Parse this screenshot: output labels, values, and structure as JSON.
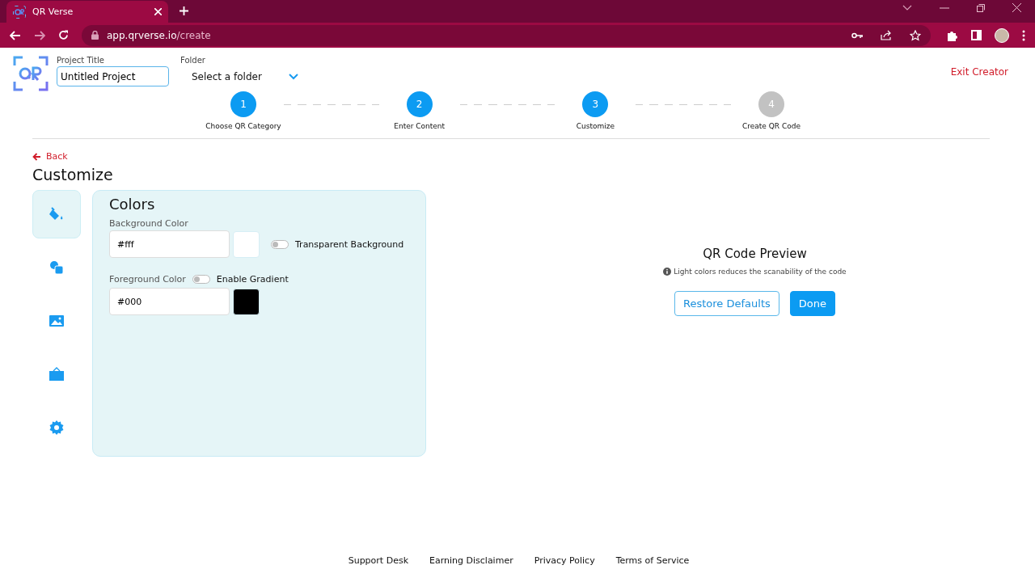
{
  "browser": {
    "tab_title": "QR Verse",
    "url_host": "app.qrverse.io",
    "url_path": "/create"
  },
  "header": {
    "project_title_label": "Project Title",
    "project_title": "Untitled Project",
    "folder_label": "Folder",
    "folder_value": "Select a folder",
    "exit": "Exit Creator"
  },
  "steps": [
    {
      "number": "1",
      "label": "Choose QR Category",
      "done": true
    },
    {
      "number": "2",
      "label": "Enter Content",
      "done": true
    },
    {
      "number": "3",
      "label": "Customize",
      "done": true
    },
    {
      "number": "4",
      "label": "Create QR Code",
      "done": false
    }
  ],
  "back": "Back",
  "page_title": "Customize",
  "side_tabs": [
    {
      "kind": "paint",
      "selected": true
    },
    {
      "kind": "shapes",
      "selected": false
    },
    {
      "kind": "image",
      "selected": false
    },
    {
      "kind": "frame",
      "selected": false
    },
    {
      "kind": "settings",
      "selected": false
    }
  ],
  "colors_panel": {
    "title": "Colors",
    "background": {
      "label": "Background Color",
      "value": "#fff",
      "color": "#ffffff",
      "toggle_label": "Transparent Background",
      "on": false
    },
    "foreground": {
      "label": "Foreground Color",
      "value": "#000",
      "color": "#000000",
      "toggle_label": "Enable Gradient",
      "on": false
    }
  },
  "preview": {
    "title": "QR Code Preview",
    "note": "Light colors reduces the scanability of the code",
    "buttons": [
      {
        "label": "Restore Defaults",
        "kind": "outline"
      },
      {
        "label": "Done",
        "kind": "primary"
      }
    ]
  },
  "footer": [
    "Support Desk",
    "Earning Disclaimer",
    "Privacy Policy",
    "Terms of Service"
  ]
}
